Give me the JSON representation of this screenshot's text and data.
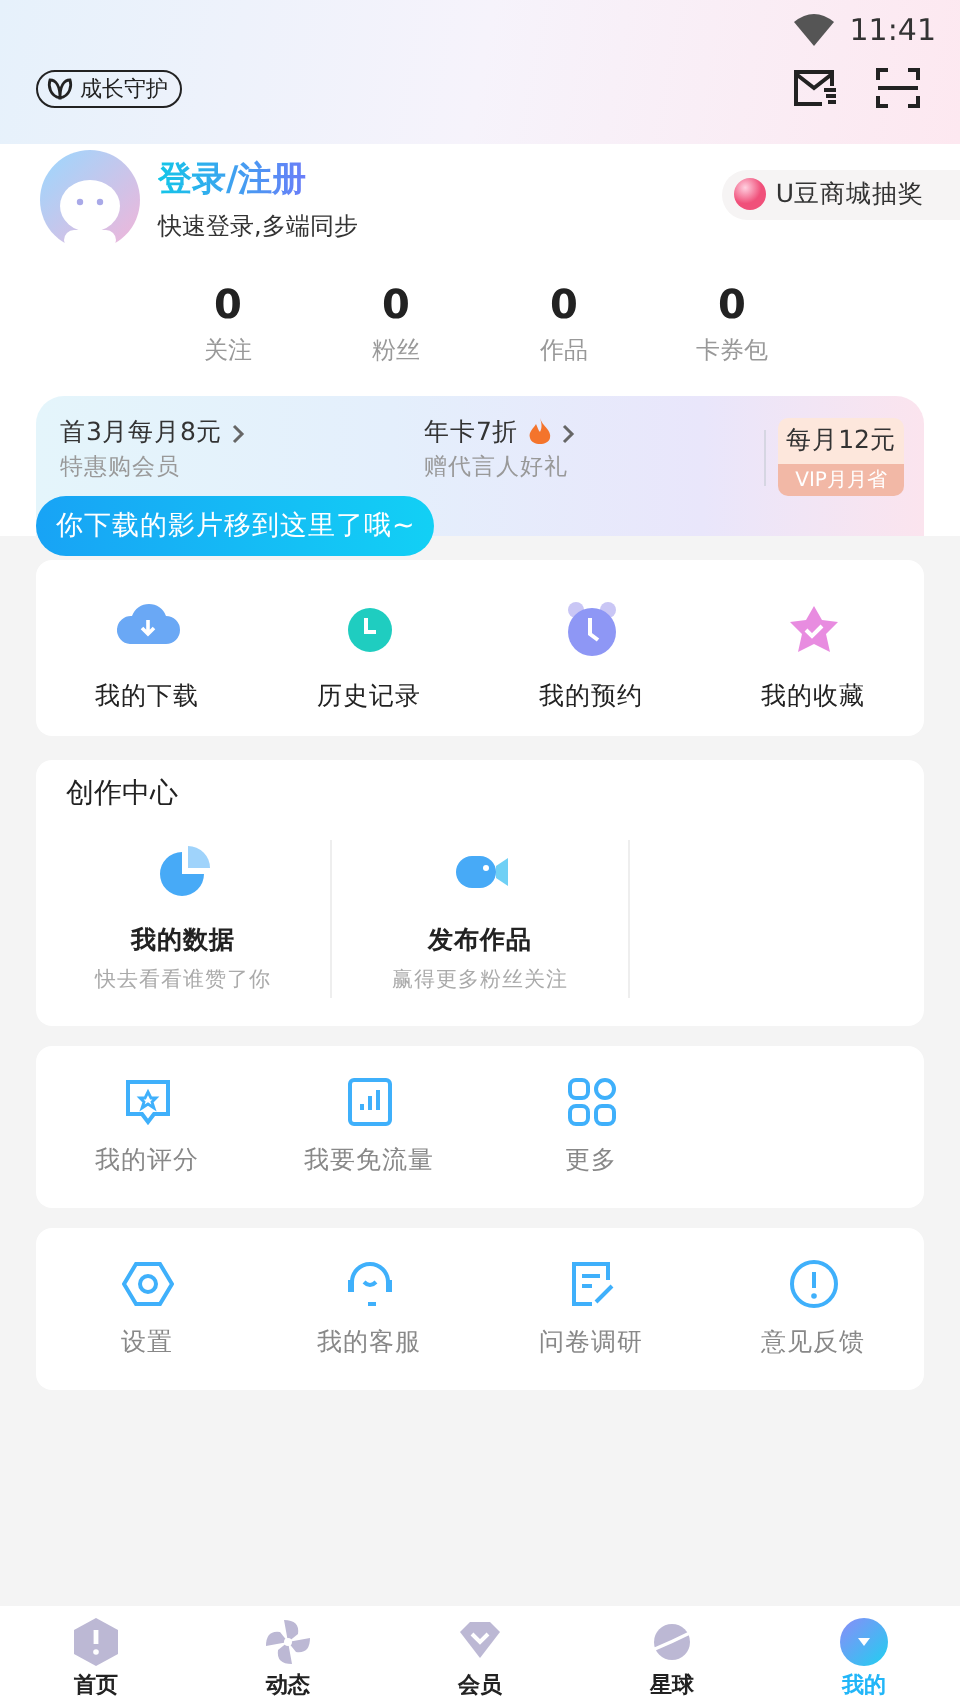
{
  "status_bar": {
    "time": "11:41"
  },
  "header": {
    "guard_label": "成长守护"
  },
  "profile": {
    "title": "登录/注册",
    "subtitle": "快速登录,多端同步",
    "promo": "U豆商城抽奖"
  },
  "stats": [
    {
      "value": "0",
      "label": "关注"
    },
    {
      "value": "0",
      "label": "粉丝"
    },
    {
      "value": "0",
      "label": "作品"
    },
    {
      "value": "0",
      "label": "卡券包"
    }
  ],
  "vip_banner": {
    "offers": [
      {
        "title": "首3月每月8元",
        "subtitle": "特惠购会员"
      },
      {
        "title": "年卡7折",
        "subtitle": "赠代言人好礼"
      }
    ],
    "price": {
      "amount": "每月12元",
      "tag": "VIP月月省"
    }
  },
  "tooltip": {
    "text": "你下载的影片移到这里了哦~"
  },
  "quick_actions": [
    {
      "label": "我的下载"
    },
    {
      "label": "历史记录"
    },
    {
      "label": "我的预约"
    },
    {
      "label": "我的收藏"
    }
  ],
  "creation_center": {
    "title": "创作中心",
    "items": [
      {
        "title": "我的数据",
        "subtitle": "快去看看谁赞了你"
      },
      {
        "title": "发布作品",
        "subtitle": "赢得更多粉丝关注"
      }
    ]
  },
  "tools": [
    {
      "label": "我的评分"
    },
    {
      "label": "我要免流量"
    },
    {
      "label": "更多"
    }
  ],
  "settings": [
    {
      "label": "设置"
    },
    {
      "label": "我的客服"
    },
    {
      "label": "问卷调研"
    },
    {
      "label": "意见反馈"
    }
  ],
  "bottom_nav": [
    {
      "label": "首页",
      "selected": false
    },
    {
      "label": "动态",
      "selected": false
    },
    {
      "label": "会员",
      "selected": false
    },
    {
      "label": "星球",
      "selected": false
    },
    {
      "label": "我的",
      "selected": true
    }
  ]
}
